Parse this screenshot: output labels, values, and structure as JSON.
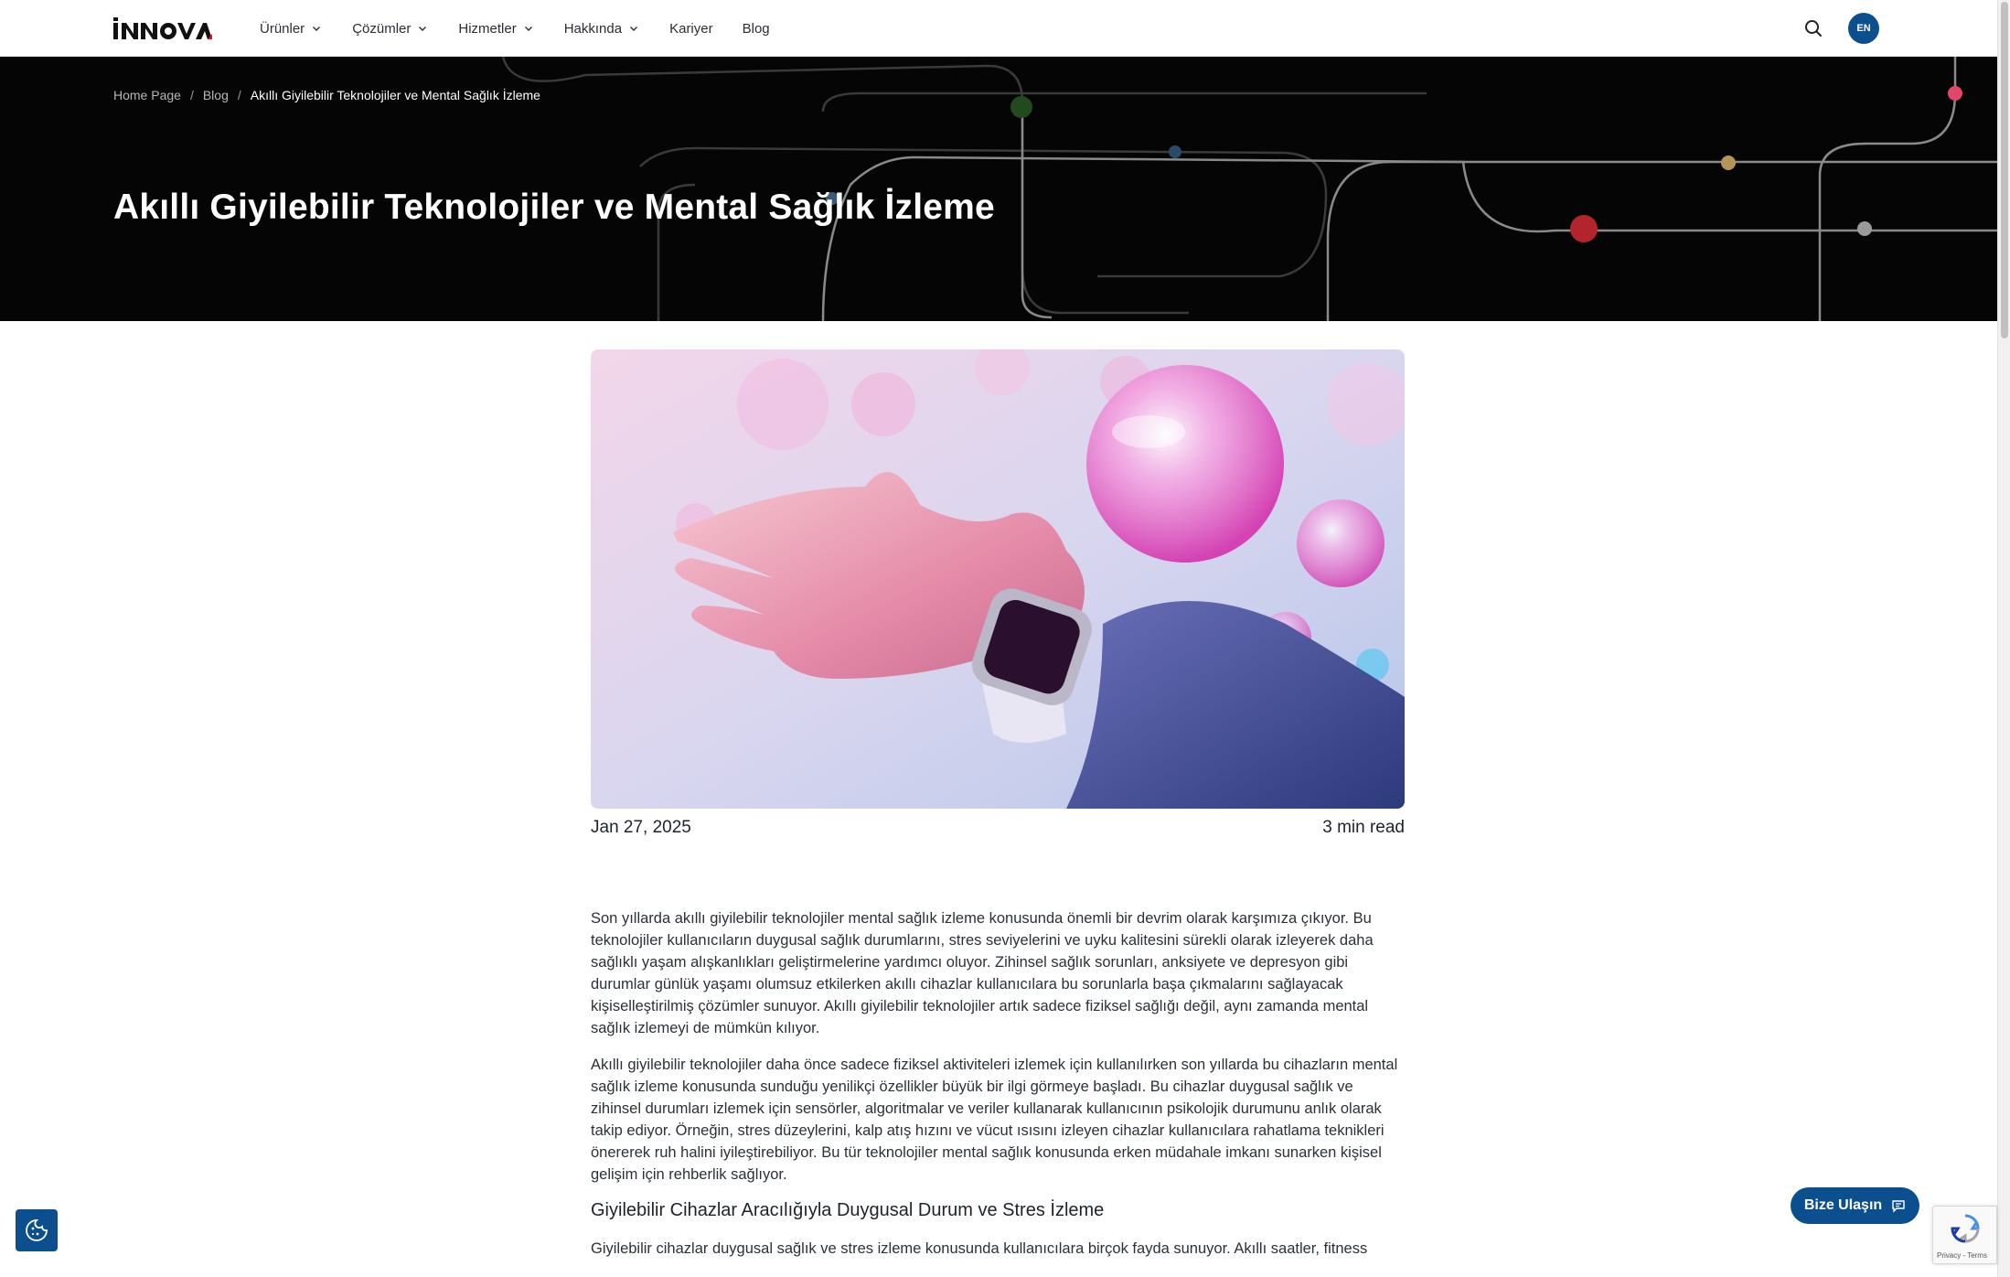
{
  "brand": {
    "logo_text": "iNNOVA",
    "accent": "#0c4f8f"
  },
  "header": {
    "nav": [
      {
        "label": "Ürünler",
        "has_dropdown": true
      },
      {
        "label": "Çözümler",
        "has_dropdown": true
      },
      {
        "label": "Hizmetler",
        "has_dropdown": true
      },
      {
        "label": "Hakkında",
        "has_dropdown": true
      },
      {
        "label": "Kariyer",
        "has_dropdown": false
      },
      {
        "label": "Blog",
        "has_dropdown": false
      }
    ],
    "search_icon": "search-icon",
    "language": "EN"
  },
  "hero": {
    "breadcrumb": {
      "home": "Home Page",
      "blog": "Blog",
      "current": "Akıllı Giyilebilir Teknolojiler ve Mental Sağlık İzleme"
    },
    "title": "Akıllı Giyilebilir Teknolojiler ve Mental Sağlık İzleme"
  },
  "article": {
    "date": "Jan 27, 2025",
    "read_time": "3 min read",
    "paragraphs": [
      "Son yıllarda akıllı giyilebilir teknolojiler mental sağlık izleme konusunda önemli bir devrim olarak karşımıza çıkıyor. Bu teknolojiler kullanıcıların duygusal sağlık durumlarını, stres seviyelerini ve uyku kalitesini sürekli olarak izleyerek daha sağlıklı yaşam alışkanlıkları geliştirmelerine yardımcı oluyor. Zihinsel sağlık sorunları, anksiyete ve depresyon gibi durumlar günlük yaşamı olumsuz etkilerken akıllı cihazlar kullanıcılara bu sorunlarla başa çıkmalarını sağlayacak kişiselleştirilmiş çözümler sunuyor. Akıllı giyilebilir teknolojiler artık sadece fiziksel sağlığı değil, aynı zamanda mental sağlık izlemeyi de mümkün kılıyor.",
      "Akıllı giyilebilir teknolojiler daha önce sadece fiziksel aktiviteleri izlemek için kullanılırken son yıllarda bu cihazların mental sağlık izleme konusunda sunduğu yenilikçi özellikler büyük bir ilgi görmeye başladı. Bu cihazlar duygusal sağlık ve zihinsel durumları izlemek için sensörler, algoritmalar ve veriler kullanarak kullanıcının psikolojik durumunu anlık olarak takip ediyor. Örneğin, stres düzeylerini, kalp atış hızını ve vücut ısısını izleyen cihazlar kullanıcılara rahatlama teknikleri önererek ruh halini iyileştirebiliyor. Bu tür teknolojiler mental sağlık konusunda erken müdahale imkanı sunarken kişisel gelişim için rehberlik sağlıyor."
    ],
    "subheading": "Giyilebilir Cihazlar Aracılığıyla Duygusal Durum ve Stres İzleme",
    "paragraph_3": "Giyilebilir cihazlar duygusal sağlık ve stres izleme konusunda kullanıcılara birçok fayda sunuyor. Akıllı saatler, fitness"
  },
  "floating": {
    "contact_label": "Bize Ulaşın",
    "cookie_icon": "cookie-icon",
    "recaptcha_label": "Privacy - Terms"
  }
}
